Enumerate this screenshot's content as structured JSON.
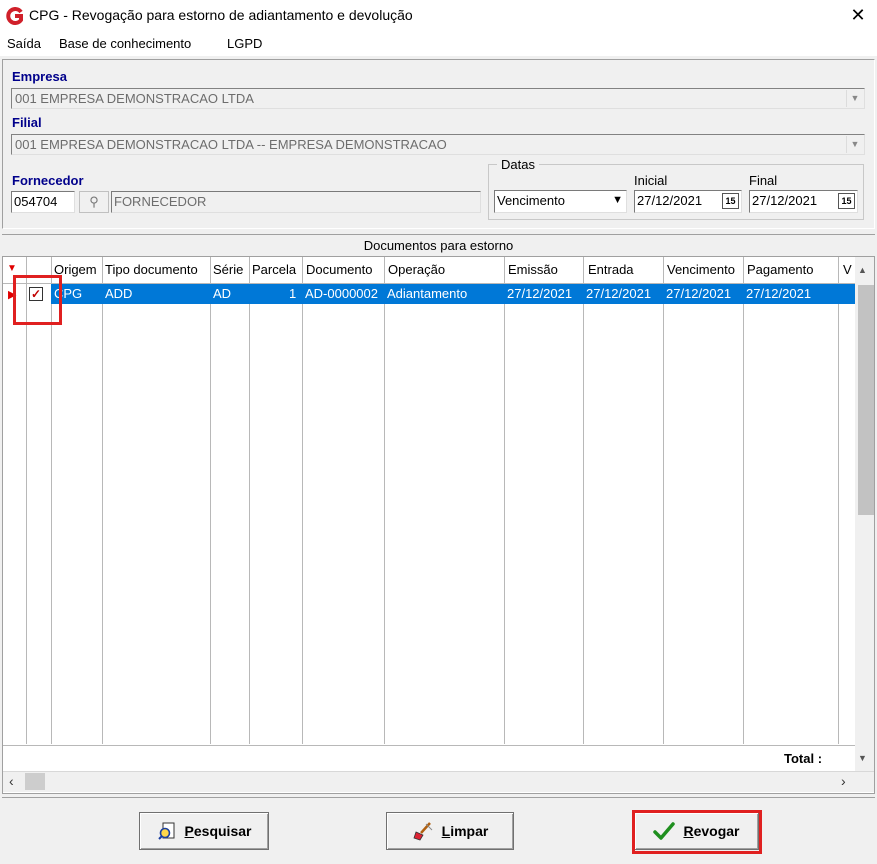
{
  "window": {
    "title": "CPG - Revogação para estorno de adiantamento e devolução",
    "close_glyph": "✕"
  },
  "menu": [
    "Saída",
    "Base de conhecimento",
    "LGPD"
  ],
  "form": {
    "empresa_label": "Empresa",
    "empresa_value": "001 EMPRESA DEMONSTRACAO LTDA",
    "filial_label": "Filial",
    "filial_value": "001 EMPRESA DEMONSTRACAO LTDA -- EMPRESA DEMONSTRACAO",
    "fornecedor_label": "Fornecedor",
    "fornecedor_code": "054704",
    "fornecedor_name": "FORNECEDOR",
    "datas_label": "Datas",
    "datas_type": "Vencimento",
    "inicial_label": "Inicial",
    "inicial_value": "27/12/2021",
    "final_label": "Final",
    "final_value": "27/12/2021",
    "calendar_icon_text": "15"
  },
  "grid": {
    "caption": "Documentos para estorno",
    "columns": [
      "Origem",
      "Tipo documento",
      "Série",
      "Parcela",
      "Documento",
      "Operação",
      "Emissão",
      "Entrada",
      "Vencimento",
      "Pagamento",
      "V"
    ],
    "rows": [
      {
        "checked": true,
        "origem": "CPG",
        "tipo": "ADD",
        "serie": "AD",
        "parcela": "1",
        "documento": "AD-0000002",
        "operacao": "Adiantamento",
        "emissao": "27/12/2021",
        "entrada": "27/12/2021",
        "vencimento": "27/12/2021",
        "pagamento": "27/12/2021"
      }
    ],
    "total_label": "Total :"
  },
  "buttons": {
    "pesquisar": {
      "first": "P",
      "rest": "esquisar"
    },
    "limpar": {
      "first": "L",
      "rest": "impar"
    },
    "revogar": {
      "first": "R",
      "rest": "evogar"
    }
  },
  "colors": {
    "selection": "#0078d7",
    "label": "#00008b",
    "highlight": "#e02020"
  }
}
